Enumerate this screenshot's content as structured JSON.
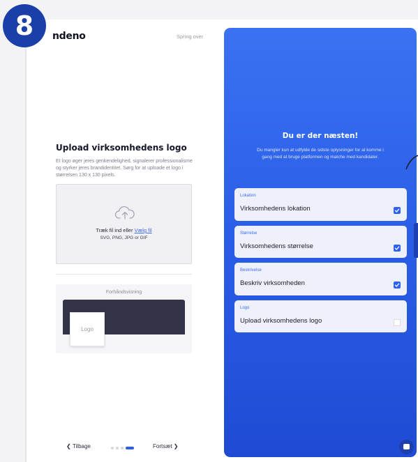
{
  "step_badge": "8",
  "brand": "ndeno",
  "skip_label": "Spring over",
  "upload": {
    "title": "Upload virksomhedens logo",
    "description": "Et logo øger jeres genkendelighed, signalerer professionalisme og styrker jeres brandidentitet. Sørg for at uploade et logo i størrelsen 130 x 130 pixels.",
    "drop_text": "Træk fil ind eller",
    "drop_link": "Vælg fil",
    "formats": "SVG, PNG, JPG or GIF",
    "icon": "cloud-upload-icon"
  },
  "preview": {
    "label": "Forhåndsvisning",
    "logo_text": "Logo"
  },
  "nav": {
    "back_label": "Tilbage",
    "next_label": "Fortsæt",
    "steps_total": 4,
    "current_step": 4
  },
  "panel": {
    "title": "Du er der næsten!",
    "subtitle": "Du mangler kun at udfylde de sidste oplysninger for at komme i gang med at bruge platformen og matche med kandidater.",
    "cards": [
      {
        "label": "Lokation",
        "value": "Virksomhedens lokation",
        "checked": true
      },
      {
        "label": "Størrelse",
        "value": "Virksomhedens størrelse",
        "checked": true
      },
      {
        "label": "Beskrivelse",
        "value": "Beskriv virksomheden",
        "checked": true
      },
      {
        "label": "Logo",
        "value": "Upload virksomhedens logo",
        "checked": false
      }
    ]
  },
  "colors": {
    "accent": "#2f62f0",
    "panel_top": "#3a72f2",
    "panel_bottom": "#1f4bd4",
    "badge": "#1a3fa8"
  }
}
